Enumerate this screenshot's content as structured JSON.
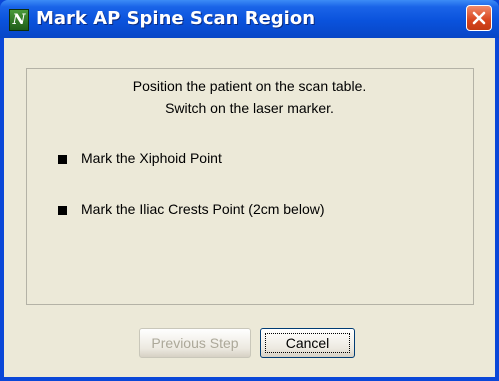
{
  "window": {
    "title": "Mark AP Spine Scan Region",
    "app_icon_letter": "N"
  },
  "instructions": {
    "line1": "Position the patient on the scan table.",
    "line2": "Switch on the laser marker."
  },
  "steps": [
    {
      "label": "Mark the Xiphoid Point"
    },
    {
      "label": "Mark the Iliac Crests Point (2cm below)"
    }
  ],
  "buttons": {
    "previous_label": "Previous Step",
    "previous_enabled": false,
    "cancel_label": "Cancel"
  },
  "colors": {
    "titlebar": "#0a52dc",
    "dialog_background": "#ece9d8",
    "close_button": "#d8451e"
  }
}
